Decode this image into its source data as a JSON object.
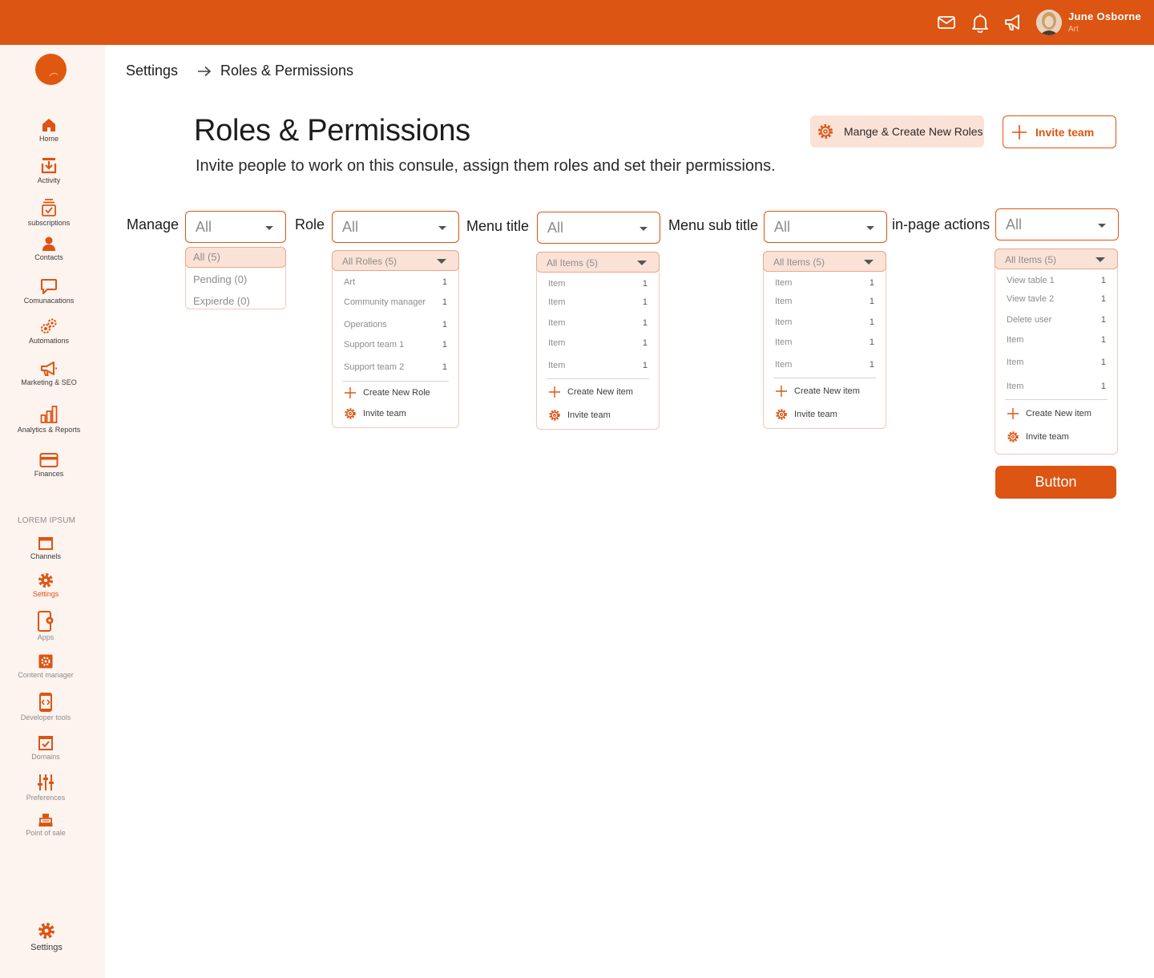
{
  "header": {
    "user_name": "June  Osborne",
    "user_role": "Art",
    "icons": [
      "mail-icon",
      "bell-icon",
      "megaphone-icon"
    ]
  },
  "sidebar": {
    "items": [
      {
        "label": "Home",
        "icon": "home-icon"
      },
      {
        "label": "Activity",
        "icon": "download-tray-icon"
      },
      {
        "label": "subscriptions",
        "icon": "stack-check-icon"
      },
      {
        "label": "Contacts",
        "icon": "person-icon"
      },
      {
        "label": "Comunacations",
        "icon": "chat-bubble-icon"
      },
      {
        "label": "Automations",
        "icon": "gears-icon"
      },
      {
        "label": "Marketing & SEO",
        "icon": "megaphone-icon"
      },
      {
        "label": "Analytics & Reports",
        "icon": "bar-chart-icon"
      },
      {
        "label": "Finances",
        "icon": "card-icon"
      }
    ],
    "section_label": "LOREM IPSUM",
    "section_items": [
      {
        "label": "Channels",
        "icon": "window-icon"
      },
      {
        "label": "Settings",
        "icon": "gear-icon",
        "active": true
      },
      {
        "label": "Apps",
        "icon": "tablet-gear-icon"
      },
      {
        "label": "Content manager",
        "icon": "gear-box-icon"
      },
      {
        "label": "Developer tools",
        "icon": "code-device-icon"
      },
      {
        "label": "Domains",
        "icon": "checkbox-icon"
      },
      {
        "label": "Preferences",
        "icon": "sliders-icon"
      },
      {
        "label": "Point of sale",
        "icon": "register-icon"
      }
    ],
    "footer_label": "Settings"
  },
  "breadcrumb": {
    "parent": "Settings",
    "current": "Roles & Permissions"
  },
  "page": {
    "title": "Roles & Permissions",
    "subtitle": "Invite people to work on this consule, assign them roles and set their permissions.",
    "manage_roles_button": "Mange & Create New Roles",
    "invite_button": "Invite team",
    "primary_button": "Button"
  },
  "filters": {
    "manage": {
      "label": "Manage",
      "value": "All",
      "options": [
        "All (5)",
        "Pending (0)",
        "Expierde (0)"
      ]
    },
    "role": {
      "label": "Role",
      "value": "All",
      "head": "All Rolles (5)",
      "rows": [
        {
          "name": "Art",
          "count": "1"
        },
        {
          "name": "Community manager",
          "count": "1"
        },
        {
          "name": "Operations",
          "count": "1"
        },
        {
          "name": "Support team 1",
          "count": "1"
        },
        {
          "name": "Support team 2",
          "count": "1"
        }
      ],
      "create": "Create New Role",
      "invite": "Invite team"
    },
    "menu_title": {
      "label": "Menu title",
      "value": "All",
      "head": "All Items (5)",
      "rows": [
        {
          "name": "Item",
          "count": "1"
        },
        {
          "name": "Item",
          "count": "1"
        },
        {
          "name": "Item",
          "count": "1"
        },
        {
          "name": "Item",
          "count": "1"
        },
        {
          "name": "Item",
          "count": "1"
        }
      ],
      "create": "Create New item",
      "invite": "Invite team"
    },
    "menu_sub_title": {
      "label": "Menu sub title",
      "value": "All",
      "head": "All Items (5)",
      "rows": [
        {
          "name": "Item",
          "count": "1"
        },
        {
          "name": "Item",
          "count": "1"
        },
        {
          "name": "Item",
          "count": "1"
        },
        {
          "name": "Item",
          "count": "1"
        },
        {
          "name": "Item",
          "count": "1"
        }
      ],
      "create": "Create New item",
      "invite": "Invite team"
    },
    "in_page_actions": {
      "label": "in-page actions",
      "value": "All",
      "head": "All Items (5)",
      "rows": [
        {
          "name": "View table 1",
          "count": "1"
        },
        {
          "name": "View tavle 2",
          "count": "1"
        },
        {
          "name": "Delete user",
          "count": "1"
        },
        {
          "name": "Item",
          "count": "1"
        },
        {
          "name": "Item",
          "count": "1"
        },
        {
          "name": "Item",
          "count": "1"
        }
      ],
      "create": "Create New item",
      "invite": "Invite team"
    }
  },
  "colors": {
    "brand": "#dc5512",
    "sidebar_bg": "#fdf3ef",
    "tint": "#fbe2d7"
  }
}
